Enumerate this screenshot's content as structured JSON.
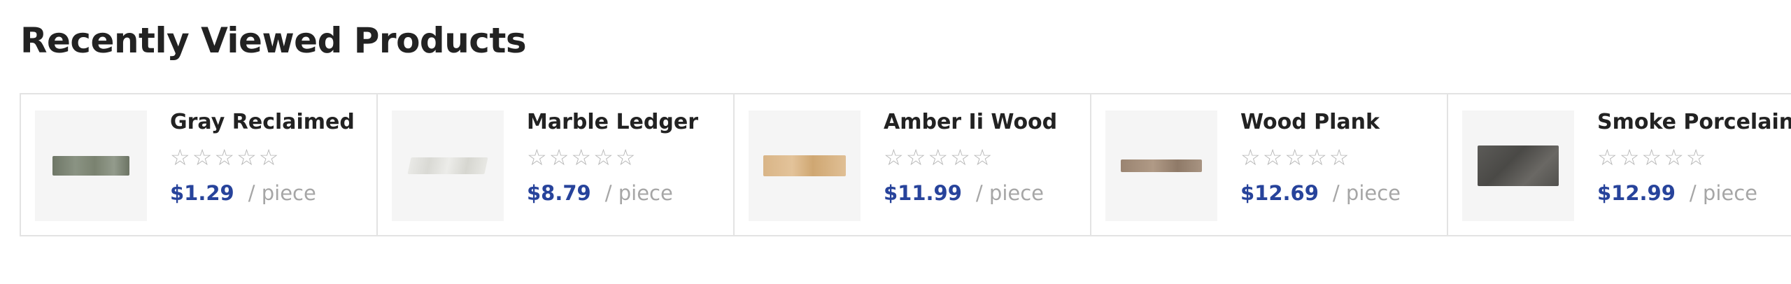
{
  "section": {
    "title": "Recently Viewed Products"
  },
  "colors": {
    "price": "#27439b",
    "star_outline": "#b5b5b5",
    "unit_text": "#a6a6a6",
    "border": "#e3e3e3",
    "thumb_bg": "#f5f5f5"
  },
  "star_icon": "star-outline-icon",
  "products": [
    {
      "name": "Gray Reclaimed",
      "rating": 0,
      "max_rating": 5,
      "price": "$1.29",
      "unit": "/ piece"
    },
    {
      "name": "Marble Ledger",
      "rating": 0,
      "max_rating": 5,
      "price": "$8.79",
      "unit": "/ piece"
    },
    {
      "name": "Amber Ii Wood",
      "rating": 0,
      "max_rating": 5,
      "price": "$11.99",
      "unit": "/ piece"
    },
    {
      "name": "Wood Plank",
      "rating": 0,
      "max_rating": 5,
      "price": "$12.69",
      "unit": "/ piece"
    },
    {
      "name": "Smoke Porcelain",
      "rating": 0,
      "max_rating": 5,
      "price": "$12.99",
      "unit": "/ piece"
    }
  ]
}
